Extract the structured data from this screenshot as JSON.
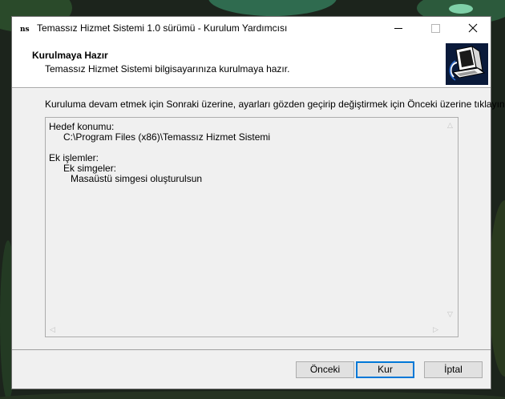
{
  "window": {
    "title": "Temassız Hizmet Sistemi 1.0 sürümü - Kurulum Yardımcısı",
    "app_icon_text": "ns"
  },
  "header": {
    "title": "Kurulmaya Hazır",
    "subtitle": "Temassız Hizmet Sistemi bilgisayarınıza kurulmaya hazır."
  },
  "body": {
    "instruction": "Kuruluma devam etmek için Sonraki üzerine, ayarları gözden geçirip değiştirmek için Önceki üzerine tıklayın."
  },
  "memo": {
    "dest_label": "Hedef konumu:",
    "dest_path": "C:\\Program Files (x86)\\Temassız Hizmet Sistemi",
    "tasks_label": "Ek işlemler:",
    "tasks_group": "Ek simgeler:",
    "tasks_item": "Masaüstü simgesi oluşturulsun"
  },
  "buttons": {
    "back": "Önceki",
    "install": "Kur",
    "cancel": "İptal"
  },
  "colors": {
    "accent": "#0078d7",
    "wizard_image_bg": "#0a1a3a"
  }
}
